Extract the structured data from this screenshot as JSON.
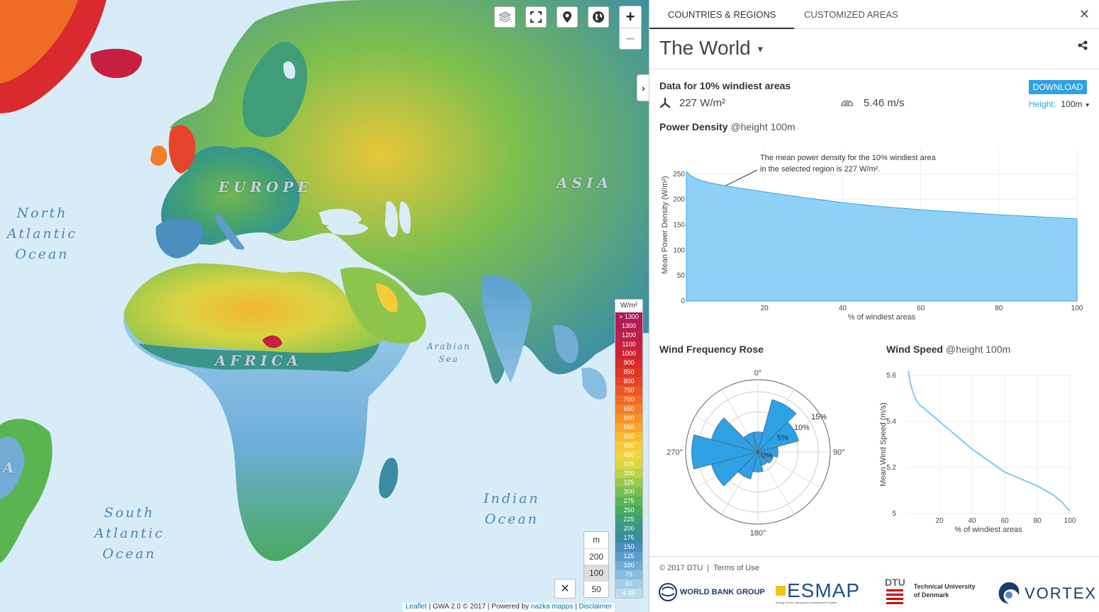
{
  "map": {
    "ocean_labels": {
      "north_atlantic": [
        "North",
        "Atlantic",
        "Ocean"
      ],
      "south_atlantic": [
        "South",
        "Atlantic",
        "Ocean"
      ],
      "indian": [
        "Indian",
        "Ocean"
      ],
      "arabian": [
        "Arabian",
        "Sea"
      ]
    },
    "continents": {
      "europe": "EUROPE",
      "asia": "ASIA",
      "africa": "AFRICA",
      "left_edge": "A"
    },
    "controls": {
      "zoom_in": "+",
      "zoom_out": "−"
    },
    "legend": {
      "unit": "W/m²",
      "items": [
        {
          "label": "> 1300",
          "color": "#a81e56"
        },
        {
          "label": "1300",
          "color": "#b21e50"
        },
        {
          "label": "1200",
          "color": "#bc1f48"
        },
        {
          "label": "1100",
          "color": "#c61f40"
        },
        {
          "label": "1000",
          "color": "#d02235"
        },
        {
          "label": "900",
          "color": "#d92a2d"
        },
        {
          "label": "850",
          "color": "#e0352a"
        },
        {
          "label": "800",
          "color": "#e64428"
        },
        {
          "label": "750",
          "color": "#eb5727"
        },
        {
          "label": "700",
          "color": "#ef6b26"
        },
        {
          "label": "650",
          "color": "#f27e27"
        },
        {
          "label": "600",
          "color": "#f4922a"
        },
        {
          "label": "550",
          "color": "#f6a72e"
        },
        {
          "label": "500",
          "color": "#f6bb33"
        },
        {
          "label": "450",
          "color": "#f5cc38"
        },
        {
          "label": "400",
          "color": "#eed63c"
        },
        {
          "label": "375",
          "color": "#d9d741"
        },
        {
          "label": "350",
          "color": "#bcd247"
        },
        {
          "label": "325",
          "color": "#9ac94c"
        },
        {
          "label": "300",
          "color": "#78bf4f"
        },
        {
          "label": "275",
          "color": "#5bb452"
        },
        {
          "label": "250",
          "color": "#48a95f"
        },
        {
          "label": "225",
          "color": "#3e9e74"
        },
        {
          "label": "200",
          "color": "#3b958a"
        },
        {
          "label": "175",
          "color": "#3b8ba3"
        },
        {
          "label": "150",
          "color": "#4a8fc0"
        },
        {
          "label": "125",
          "color": "#5d9dcc"
        },
        {
          "label": "100",
          "color": "#72acd6"
        },
        {
          "label": "75",
          "color": "#89bde0"
        },
        {
          "label": "50",
          "color": "#a2cde8"
        },
        {
          "label": "< 25",
          "color": "#bcdcef"
        }
      ]
    },
    "height_selector": {
      "unit": "m",
      "options": [
        "200",
        "100",
        "50"
      ],
      "selected": "100"
    },
    "close_label": "✕",
    "attribution": {
      "leaflet": "Leaflet",
      "gwa": "GWA 2.0 © 2017",
      "powered": "Powered by",
      "nazka": "nazka mapps",
      "disclaimer": "Disclaimer"
    }
  },
  "panel": {
    "tabs": [
      "COUNTRIES & REGIONS",
      "CUSTOMIZED AREAS"
    ],
    "active_tab": 0,
    "close": "✕",
    "region": "The World",
    "summary": {
      "title": "Data for 10% windiest areas",
      "power_density": "227 W/m²",
      "wind_speed": "5.46 m/s",
      "download": "DOWNLOAD",
      "height_label": "Height:",
      "height_value": "100m"
    },
    "power_density": {
      "title": "Power Density",
      "subtitle": "@height 100m",
      "annotation_line1": "The mean power density for the 10% windiest area",
      "annotation_line2": "in the selected region is 227 W/m².",
      "ylabel": "Mean Power Density (W/m²)",
      "xlabel": "% of windiest areas"
    },
    "wind_rose": {
      "title": "Wind Frequency Rose",
      "angle_labels": [
        "0°",
        "90°",
        "180°",
        "270°"
      ],
      "radial_labels": [
        "0%",
        "5%",
        "10%",
        "15%"
      ]
    },
    "wind_speed": {
      "title": "Wind Speed",
      "subtitle": "@height 100m",
      "ylabel": "Mean Wind Speed (m/s)",
      "xlabel": "% of windiest areas"
    },
    "footer": {
      "copyright": "© 2017 DTU",
      "terms": "Terms of Use",
      "logos": {
        "worldbank": "WORLD BANK GROUP",
        "esmap": "ESMAP",
        "esmap_sub": "Energy Sector Management Assistance Program",
        "dtu": "DTU",
        "dtu_name1": "Technical University",
        "dtu_name2": "of Denmark",
        "vortex": "VORTEX"
      }
    }
  },
  "chart_data": [
    {
      "type": "area",
      "title": "Power Density",
      "xlabel": "% of windiest areas",
      "ylabel": "Mean Power Density (W/m²)",
      "xlim": [
        0,
        100
      ],
      "ylim": [
        0,
        300
      ],
      "xticks": [
        20,
        40,
        60,
        80,
        100
      ],
      "yticks": [
        0,
        50,
        100,
        150,
        200,
        250
      ],
      "x": [
        0,
        1,
        2,
        4,
        6,
        8,
        10,
        15,
        20,
        30,
        40,
        50,
        60,
        70,
        80,
        90,
        100
      ],
      "y": [
        255,
        248,
        243,
        237,
        233,
        230,
        227,
        221,
        215,
        204,
        194,
        186,
        180,
        175,
        170,
        166,
        162
      ],
      "color": "#8fd0f7"
    },
    {
      "type": "polar_bar",
      "title": "Wind Frequency Rose",
      "unit": "%",
      "rmax": 18,
      "directions": [
        0,
        30,
        60,
        90,
        120,
        150,
        180,
        210,
        240,
        270,
        300,
        330
      ],
      "values": [
        5,
        13.5,
        10.5,
        5,
        4,
        3.5,
        5,
        7,
        12,
        16.5,
        12,
        5
      ],
      "color": "#2ea1e6"
    },
    {
      "type": "line",
      "title": "Wind Speed",
      "xlabel": "% of windiest areas",
      "ylabel": "Mean Wind Speed (m/s)",
      "xlim": [
        0,
        100
      ],
      "ylim": [
        5,
        5.6
      ],
      "xticks": [
        20,
        40,
        60,
        80,
        100
      ],
      "yticks": [
        5,
        5.2,
        5.4,
        5.6
      ],
      "x": [
        1,
        2,
        4,
        6,
        8,
        10,
        15,
        20,
        30,
        40,
        50,
        60,
        70,
        80,
        90,
        95,
        100
      ],
      "y": [
        5.62,
        5.57,
        5.52,
        5.49,
        5.47,
        5.46,
        5.43,
        5.4,
        5.34,
        5.28,
        5.23,
        5.18,
        5.15,
        5.12,
        5.08,
        5.05,
        5.01
      ],
      "color": "#7fc8f0"
    }
  ]
}
